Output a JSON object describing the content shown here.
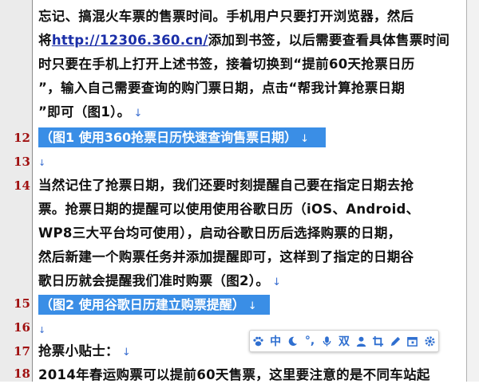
{
  "editor": {
    "lines": [
      {
        "text": "忘记、搞混火车票的售票时间。手机用户只要打开浏览器，然后"
      },
      {
        "before": "将",
        "url": "http://12306.360.cn/",
        "after": "添加到书签，以后需要查看具体售票时间"
      },
      {
        "text": "时只要在手机上打开上述书签，接着切换到“提前60天抢票日历"
      },
      {
        "text": "”，输入自己需要查询的购门票日期，点击“帮我计算抢票日期"
      },
      {
        "text": "”即可（图1）。",
        "mark": "↓"
      },
      {
        "num": "12",
        "selected": "（图1 使用360抢票日历快速查询售票日期）",
        "mark": "↓"
      },
      {
        "num": "13",
        "mark": "↓"
      },
      {
        "num": "14",
        "text": "当然记住了抢票日期，我们还要时刻提醒自己要在指定日期去抢"
      },
      {
        "text": "票。抢票日期的提醒可以使用使用谷歌日历（iOS、Android、"
      },
      {
        "text": "WP8三大平台均可使用），启动谷歌日历后选择购票的日期，"
      },
      {
        "text": "然后新建一个购票任务并添加提醒即可，这样到了指定的日期谷"
      },
      {
        "text": "歌日历就会提醒我们准时购票（图2）。",
        "mark": "↓"
      },
      {
        "num": "15",
        "selected": "（图2 使用谷歌日历建立购票提醒）",
        "mark": "↓"
      },
      {
        "num": "16",
        "mark": "↓"
      },
      {
        "num": "17",
        "text": "抢票小贴士：",
        "mark": "↓"
      },
      {
        "num": "18",
        "text": "2014年春运购票可以提前60天售票，这里要注意的是不同车站起"
      }
    ]
  },
  "toolbar": {
    "buttons": [
      {
        "name": "paw-icon"
      },
      {
        "name": "chinese-input-button",
        "label": "中"
      },
      {
        "name": "half-width-moon-icon"
      },
      {
        "name": "punctuation-button",
        "label": "°,"
      },
      {
        "name": "microphone-icon"
      },
      {
        "name": "double-pinyin-button",
        "label": "双"
      },
      {
        "name": "user-icon"
      },
      {
        "name": "crop-icon"
      },
      {
        "name": "pen-icon"
      },
      {
        "name": "calendar-icon"
      },
      {
        "name": "settings-gear-icon"
      }
    ]
  }
}
